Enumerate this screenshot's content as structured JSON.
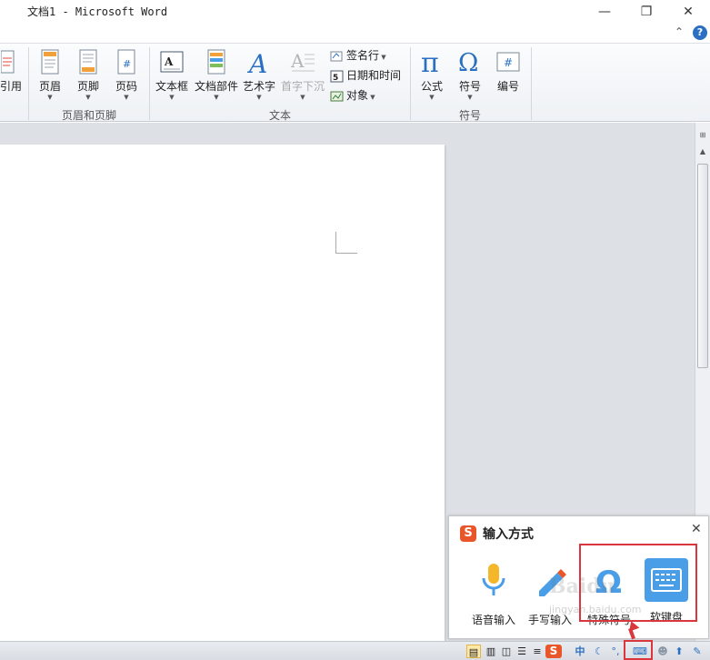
{
  "window": {
    "title": "文档1 - Microsoft Word",
    "minimize_glyph": "—",
    "restore_glyph": "❐",
    "close_glyph": "✕",
    "collapse_ribbon_glyph": "⌃",
    "help_glyph": "?"
  },
  "ribbon": {
    "partial_left_label": "引用",
    "groups": {
      "header_footer": {
        "label": "页眉和页脚",
        "buttons": [
          "页眉",
          "页脚",
          "页码"
        ]
      },
      "text": {
        "label": "文本",
        "buttons": [
          "文本框",
          "文档部件",
          "艺术字",
          "首字下沉"
        ],
        "small_buttons": [
          "签名行",
          "日期和时间",
          "对象"
        ]
      },
      "symbols": {
        "label": "符号",
        "buttons": [
          "公式",
          "符号",
          "编号"
        ]
      }
    }
  },
  "ime_popup": {
    "title": "输入方式",
    "logo_letter": "S",
    "close_glyph": "✕",
    "items": [
      "语音输入",
      "手写输入",
      "特殊符号",
      "软键盘"
    ]
  },
  "statusbar": {
    "ime_logo": "S",
    "ime_lang": "中",
    "ime_punct": "°,"
  },
  "watermark": {
    "brand": "Baidu",
    "site": "jingyan.baidu.com"
  },
  "colors": {
    "accent_red": "#d9363e",
    "ime_orange": "#e8562a",
    "keyboard_blue": "#4a9ee8",
    "icon_blue": "#2a6fc1"
  }
}
